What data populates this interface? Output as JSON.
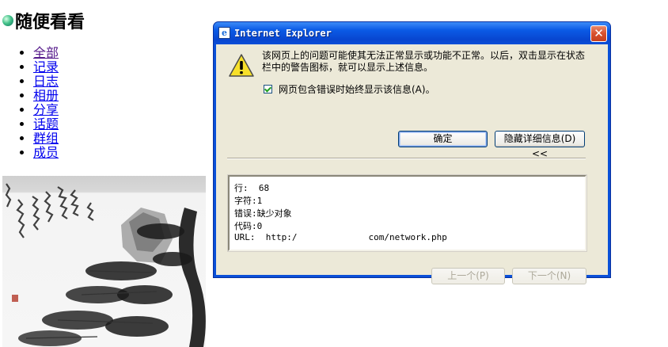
{
  "page": {
    "title": "随便看看",
    "nav": [
      "全部",
      "记录",
      "日志",
      "相册",
      "分享",
      "话题",
      "群组",
      "成员"
    ]
  },
  "dialog": {
    "title": "Internet Explorer",
    "close_glyph": "✕",
    "message": "该网页上的问题可能使其无法正常显示或功能不正常。以后，双击显示在状态栏中的警告图标，就可以显示上述信息。",
    "checkbox_label": "网页包含错误时始终显示该信息(A)。",
    "checkbox_checked": true,
    "ok_label": "确定",
    "details_label": "隐藏详细信息(D) <<",
    "details": {
      "line_label": "行:",
      "line_value": "68",
      "char_label": "字符:",
      "char_value": "1",
      "error_label": "错误:",
      "error_value": "缺少对象",
      "code_label": "代码:",
      "code_value": "0",
      "url_label": "URL:",
      "url_prefix": "http:/",
      "url_suffix": "com/network.php"
    },
    "prev_label": "上一个(P)",
    "next_label": "下一个(N)"
  },
  "colors": {
    "titlebar": "#0a50d8",
    "dialog_bg": "#ece9d8",
    "link": "#0000ee",
    "visited_link": "#551a8b"
  },
  "icons": {
    "title_icon": "ie-icon",
    "warning": "warning-icon",
    "close": "close-icon",
    "heading_bullet": "green-orb-icon"
  }
}
